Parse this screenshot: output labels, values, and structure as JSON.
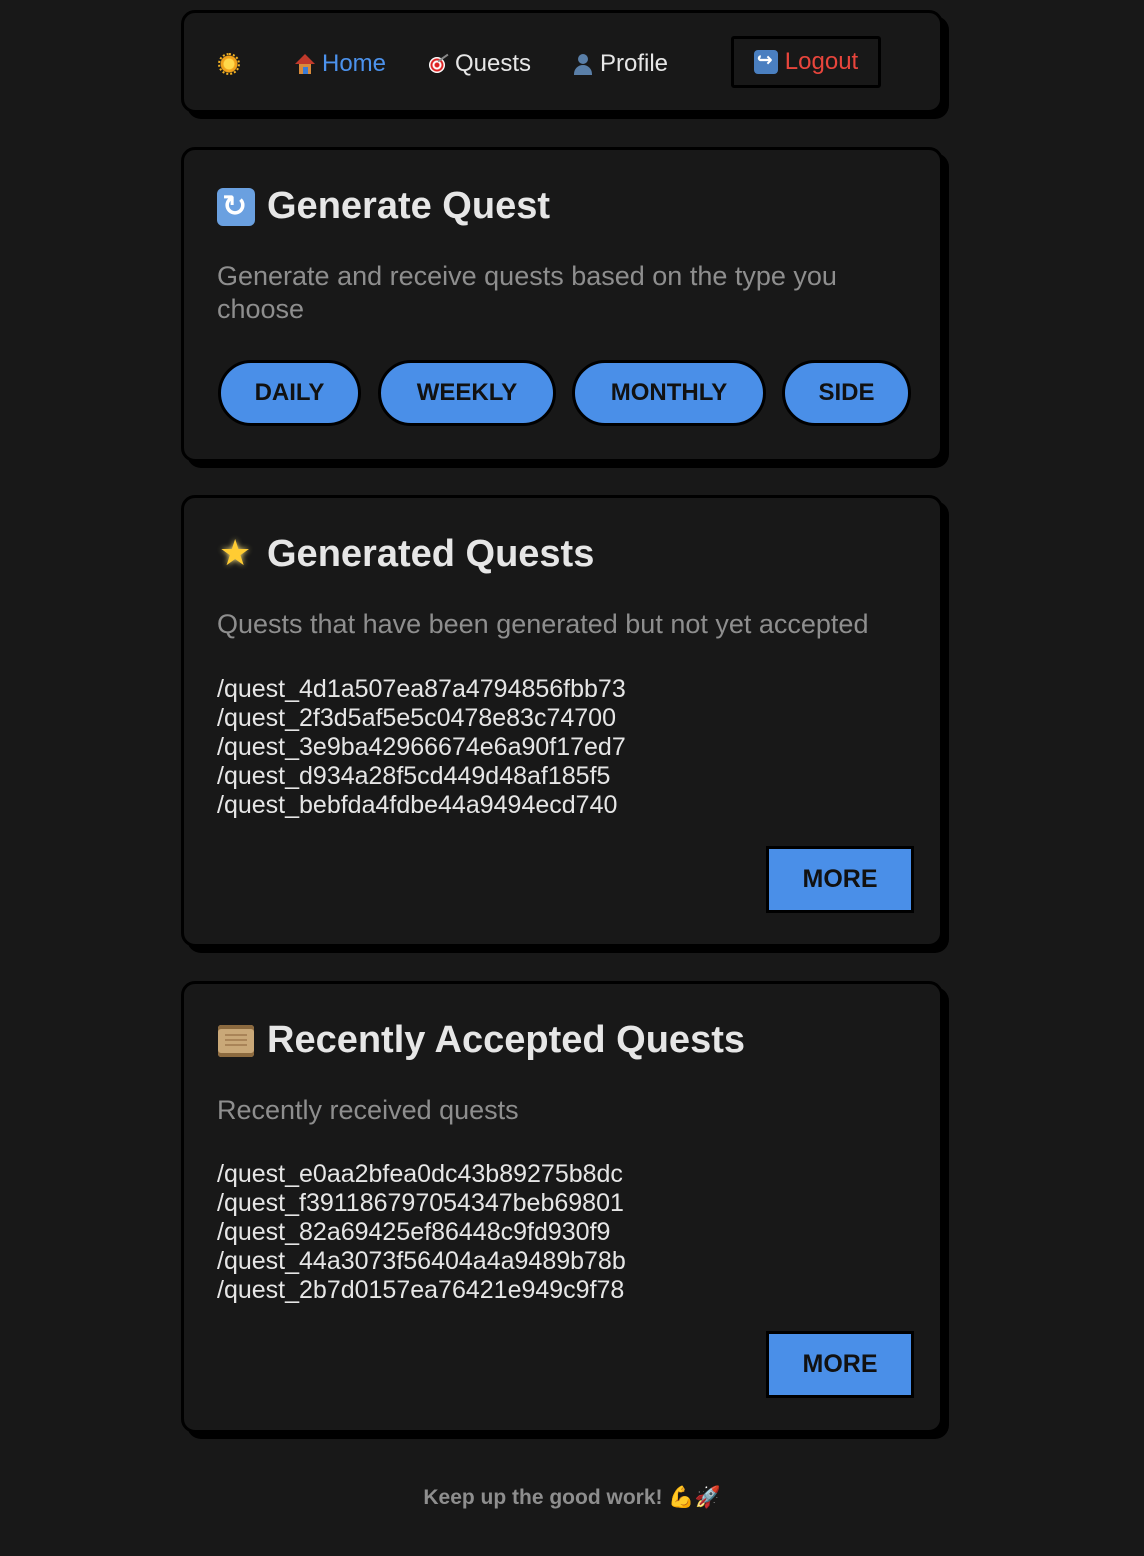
{
  "nav": {
    "logo_icon": "sun-icon",
    "items": [
      {
        "label": "Home",
        "icon": "house-icon",
        "active": true
      },
      {
        "label": "Quests",
        "icon": "target-icon"
      },
      {
        "label": "Profile",
        "icon": "person-icon"
      }
    ],
    "logout": {
      "label": "Logout",
      "icon": "logout-arrow-icon"
    }
  },
  "generate": {
    "icon": "refresh-icon",
    "title": "Generate Quest",
    "description": "Generate and receive quests based on the type you choose",
    "types": [
      "DAILY",
      "WEEKLY",
      "MONTHLY",
      "SIDE"
    ]
  },
  "generated": {
    "icon": "glowing-star-icon",
    "title": "Generated Quests",
    "description": "Quests that have been generated but not yet accepted",
    "quests": [
      "/quest_4d1a507ea87a4794856fbb73",
      "/quest_2f3d5af5e5c0478e83c74700",
      "/quest_3e9ba42966674e6a90f17ed7",
      "/quest_d934a28f5cd449d48af185f5",
      "/quest_bebfda4fdbe44a9494ecd740"
    ],
    "more_label": "MORE"
  },
  "accepted": {
    "icon": "scroll-icon",
    "title": "Recently Accepted Quests",
    "description": "Recently received quests",
    "quests": [
      "/quest_e0aa2bfea0dc43b89275b8dc",
      "/quest_f391186797054347beb69801",
      "/quest_82a69425ef86448c9fd930f9",
      "/quest_44a3073f56404a4a9489b78b",
      "/quest_2b7d0157ea76421e949c9f78"
    ],
    "more_label": "MORE"
  },
  "footer": {
    "text": "Keep up the good work! 💪🚀"
  },
  "colors": {
    "background": "#181818",
    "accent": "#4a8fe8",
    "active_link": "#4c92ec",
    "logout": "#e8453c",
    "muted": "#8e8e8e"
  }
}
